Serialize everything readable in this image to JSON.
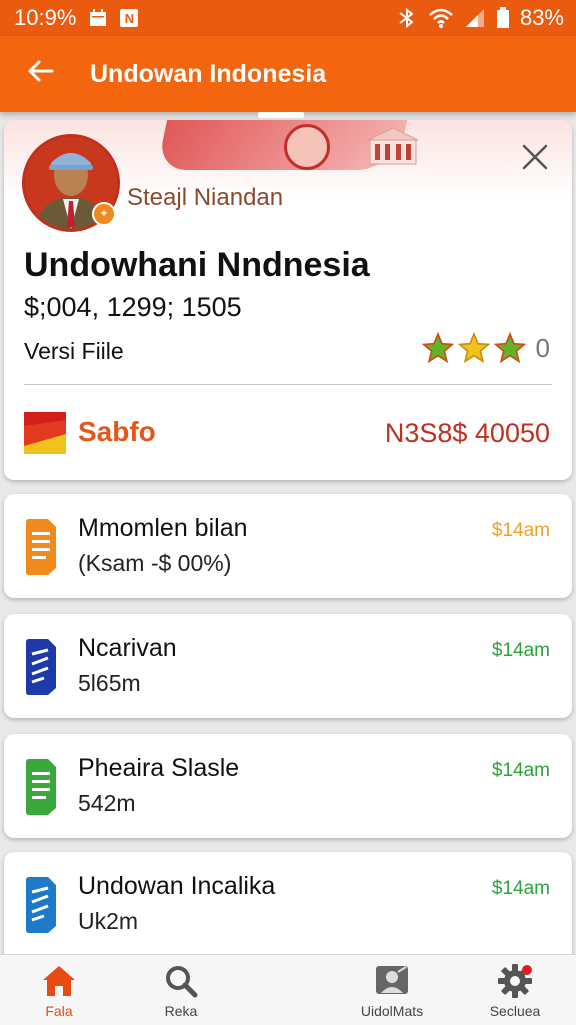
{
  "status_bar": {
    "time": "10:9%",
    "notification_badge": "N",
    "battery": "83%"
  },
  "app_bar": {
    "title": "Undowan Indonesia"
  },
  "profile": {
    "person_name": "Steajl Niandan",
    "product_title": "Undowhani Nndnesia",
    "price": "$;004, 1299; 1505",
    "version_label": "Versi Fiile",
    "rating_count": "0",
    "rating_stars": 3,
    "sabfo_label": "Sabfo",
    "sabfo_amount": "N3S8$ 40050"
  },
  "items": [
    {
      "title": "Mmomlen bilan",
      "subtitle": "(Ksam -$ 00%)",
      "time": "$14am",
      "time_color": "#f0a020",
      "icon": "orange-document-icon",
      "icon_color": "#f08a1c"
    },
    {
      "title": "Ncarivan",
      "subtitle": "5l65m",
      "time": "$14am",
      "time_color": "#2aa338",
      "icon": "blue-document-icon",
      "icon_color": "#1e3aa8"
    },
    {
      "title": "Pheaira Slasle",
      "subtitle": "542m",
      "time": "$14am",
      "time_color": "#2aa338",
      "icon": "green-document-icon",
      "icon_color": "#3aa83a"
    },
    {
      "title": "Undowan Incalika",
      "subtitle": "Uk2m",
      "time": "$14am",
      "time_color": "#2aa338",
      "icon": "light-blue-document-icon",
      "icon_color": "#1e7ac8"
    }
  ],
  "bottom_nav": [
    {
      "label": "Fala",
      "icon": "home-icon",
      "active": true
    },
    {
      "label": "Reka",
      "icon": "search-icon",
      "active": false
    },
    {
      "label": "UidolMats",
      "icon": "account-icon",
      "active": false
    },
    {
      "label": "Secluea",
      "icon": "settings-icon",
      "active": false
    }
  ],
  "colors": {
    "accent": "#f3650f",
    "status_bar": "#ea5a0f",
    "active_nav": "#e84a12"
  }
}
